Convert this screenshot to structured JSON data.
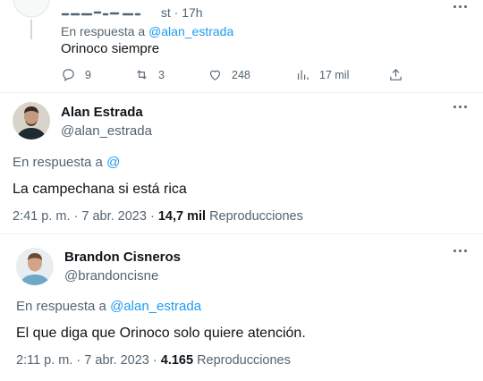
{
  "tweets": [
    {
      "header_visible_text": "st · 17h",
      "reply_prefix": "En respuesta a",
      "reply_to": "@alan_estrada",
      "text": "Orinoco siempre",
      "actions": {
        "replies": "9",
        "retweets": "3",
        "likes": "248",
        "views": "17 mil"
      }
    },
    {
      "name": "Alan Estrada",
      "handle": "@alan_estrada",
      "reply_prefix": "En respuesta a",
      "reply_to": "@",
      "text": "La campechana si está rica",
      "time": "2:41 p. m. · 7 abr. 2023 ·",
      "views_count": "14,7 mil",
      "views_label": "Reproducciones"
    },
    {
      "name": "Brandon Cisneros",
      "handle": "@brandoncisne",
      "reply_prefix": "En respuesta a",
      "reply_to": "@alan_estrada",
      "text": "El que diga que Orinoco solo quiere atención.",
      "time": "2:11 p. m. · 7 abr. 2023 ·",
      "views_count": "4.165",
      "views_label": "Reproducciones"
    }
  ],
  "icons": [
    "more-icon",
    "reply-icon",
    "retweet-icon",
    "like-icon",
    "views-icon",
    "share-icon"
  ],
  "colors": {
    "link": "#1d9bf0",
    "secondary": "#536471",
    "text": "#0f1419"
  }
}
